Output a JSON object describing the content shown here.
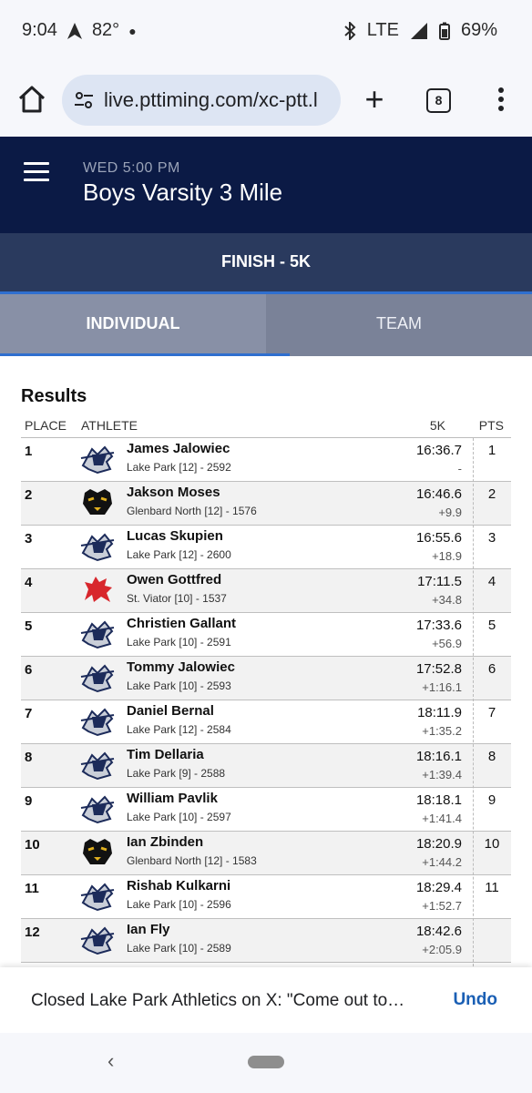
{
  "status_bar": {
    "time": "9:04",
    "temperature": "82°",
    "network": "LTE",
    "battery": "69%"
  },
  "browser": {
    "url": "live.pttiming.com/xc-ptt.l",
    "tab_count": "8"
  },
  "header": {
    "event_time": "WED 5:00 PM",
    "event_title": "Boys Varsity 3 Mile",
    "split": "FINISH - 5K"
  },
  "tabs": [
    {
      "label": "INDIVIDUAL",
      "active": true
    },
    {
      "label": "TEAM",
      "active": false
    }
  ],
  "results": {
    "title": "Results",
    "columns": {
      "place": "PLACE",
      "athlete": "ATHLETE",
      "time": "5K",
      "pts": "PTS"
    },
    "rows": [
      {
        "place": "1",
        "name": "James Jalowiec",
        "team": "Lake Park [12] - 2592",
        "time": "16:36.7",
        "gap": "-",
        "pts": "1",
        "logo": "knight-logo"
      },
      {
        "place": "2",
        "name": "Jakson Moses",
        "team": "Glenbard North [12] - 1576",
        "time": "16:46.6",
        "gap": "+9.9",
        "pts": "2",
        "logo": "panther-logo"
      },
      {
        "place": "3",
        "name": "Lucas Skupien",
        "team": "Lake Park [12] - 2600",
        "time": "16:55.6",
        "gap": "+18.9",
        "pts": "3",
        "logo": "knight-logo"
      },
      {
        "place": "4",
        "name": "Owen Gottfred",
        "team": "St. Viator [10] - 1537",
        "time": "17:11.5",
        "gap": "+34.8",
        "pts": "4",
        "logo": "lion-logo"
      },
      {
        "place": "5",
        "name": "Christien Gallant",
        "team": "Lake Park [10] - 2591",
        "time": "17:33.6",
        "gap": "+56.9",
        "pts": "5",
        "logo": "knight-logo"
      },
      {
        "place": "6",
        "name": "Tommy Jalowiec",
        "team": "Lake Park [10] - 2593",
        "time": "17:52.8",
        "gap": "+1:16.1",
        "pts": "6",
        "logo": "knight-logo"
      },
      {
        "place": "7",
        "name": "Daniel Bernal",
        "team": "Lake Park [12] - 2584",
        "time": "18:11.9",
        "gap": "+1:35.2",
        "pts": "7",
        "logo": "knight-logo"
      },
      {
        "place": "8",
        "name": "Tim Dellaria",
        "team": "Lake Park [9] - 2588",
        "time": "18:16.1",
        "gap": "+1:39.4",
        "pts": "8",
        "logo": "knight-logo"
      },
      {
        "place": "9",
        "name": "William Pavlik",
        "team": "Lake Park [10] - 2597",
        "time": "18:18.1",
        "gap": "+1:41.4",
        "pts": "9",
        "logo": "knight-logo"
      },
      {
        "place": "10",
        "name": "Ian Zbinden",
        "team": "Glenbard North [12] - 1583",
        "time": "18:20.9",
        "gap": "+1:44.2",
        "pts": "10",
        "logo": "panther-logo"
      },
      {
        "place": "11",
        "name": "Rishab Kulkarni",
        "team": "Lake Park [10] - 2596",
        "time": "18:29.4",
        "gap": "+1:52.7",
        "pts": "11",
        "logo": "knight-logo"
      },
      {
        "place": "12",
        "name": "Ian Fly",
        "team": "Lake Park [10] - 2589",
        "time": "18:42.6",
        "gap": "+2:05.9",
        "pts": "",
        "logo": "knight-logo"
      }
    ]
  },
  "snackbar": {
    "message": "Closed Lake Park Athletics on X: \"Come out to…",
    "action": "Undo"
  },
  "colors": {
    "header_bg": "#0b1a45",
    "split_bg": "#2a3a5e",
    "accent": "#2f6fcf",
    "link": "#1a5fb4"
  }
}
